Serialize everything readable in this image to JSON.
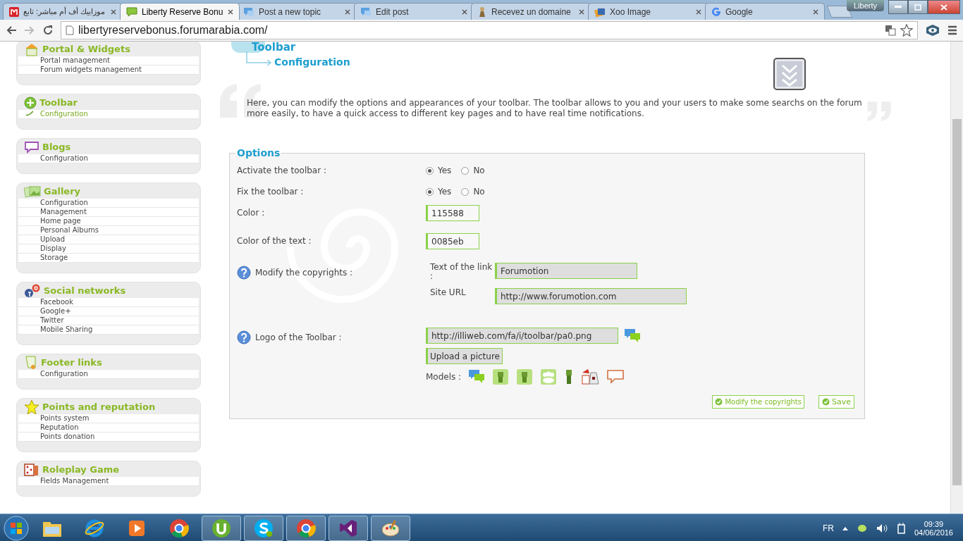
{
  "browser": {
    "tabs": [
      {
        "title": "موزاييك أف أم مباشر: تابع",
        "selected": false,
        "kind": "m"
      },
      {
        "title": "Liberty Reserve Bonu",
        "selected": true,
        "kind": "chat-green"
      },
      {
        "title": "Post a new topic",
        "selected": false,
        "kind": "chat-blue"
      },
      {
        "title": "Edit post",
        "selected": false,
        "kind": "chat-blue"
      },
      {
        "title": "Recevez un domaine",
        "selected": false,
        "kind": "figure"
      },
      {
        "title": "Xoo Image",
        "selected": false,
        "kind": "xoo"
      },
      {
        "title": "Google",
        "selected": false,
        "kind": "google"
      }
    ],
    "profile": "Liberty",
    "url": "libertyreservebonus.forumarabia.com/"
  },
  "sidebar": [
    {
      "title": "Portal & Widgets",
      "kind": "house",
      "items": [
        {
          "label": "Portal management",
          "selected": false
        },
        {
          "label": "Forum widgets management",
          "selected": false
        }
      ]
    },
    {
      "title": "Toolbar",
      "kind": "plus",
      "items": [
        {
          "label": "Configuration",
          "selected": true
        }
      ]
    },
    {
      "title": "Blogs",
      "kind": "bubble",
      "items": [
        {
          "label": "Configuration",
          "selected": false
        }
      ]
    },
    {
      "title": "Gallery",
      "kind": "photos",
      "items": [
        {
          "label": "Configuration",
          "selected": false
        },
        {
          "label": "Management",
          "selected": false
        },
        {
          "label": "Home page",
          "selected": false
        },
        {
          "label": "Personal Albums",
          "selected": false
        },
        {
          "label": "Upload",
          "selected": false
        },
        {
          "label": "Display",
          "selected": false
        },
        {
          "label": "Storage",
          "selected": false
        }
      ]
    },
    {
      "title": "Social networks",
      "kind": "social",
      "items": [
        {
          "label": "Facebook",
          "selected": false
        },
        {
          "label": "Google+",
          "selected": false
        },
        {
          "label": "Twitter",
          "selected": false
        },
        {
          "label": "Mobile Sharing",
          "selected": false
        }
      ]
    },
    {
      "title": "Footer links",
      "kind": "scroll",
      "items": [
        {
          "label": "Configuration",
          "selected": false
        }
      ]
    },
    {
      "title": "Points and reputation",
      "kind": "star",
      "items": [
        {
          "label": "Points system",
          "selected": false
        },
        {
          "label": "Reputation",
          "selected": false
        },
        {
          "label": "Points donation",
          "selected": false
        }
      ]
    },
    {
      "title": "Roleplay Game",
      "kind": "dice",
      "items": [
        {
          "label": "Fields Management",
          "selected": false
        }
      ]
    }
  ],
  "page": {
    "section": "Toolbar",
    "subsection": "Configuration",
    "description": "Here, you can modify the options and appearances of your toolbar. The toolbar allows to you and your users to make some searchs on the forum more easily, to have a quick access to different key pages and to have real time notifications.",
    "options": {
      "legend": "Options",
      "rows": [
        {
          "kind": "radio",
          "label": "Activate the toolbar :",
          "options": [
            {
              "label": "Yes",
              "selected": true
            },
            {
              "label": "No",
              "selected": false
            }
          ]
        },
        {
          "kind": "radio",
          "label": "Fix the toolbar :",
          "options": [
            {
              "label": "Yes",
              "selected": true
            },
            {
              "label": "No",
              "selected": false
            }
          ]
        },
        {
          "kind": "field",
          "label": "Color :",
          "value": "115588"
        },
        {
          "kind": "field",
          "label": "Color of the text :",
          "value": "0085eb"
        },
        {
          "kind": "group",
          "label": "Modify the copyrights :",
          "fields": [
            {
              "label": "Text of the link :",
              "value": "Forumotion"
            },
            {
              "label": "Site URL",
              "value": "http://www.forumotion.com"
            }
          ]
        },
        {
          "kind": "logo",
          "label": "Logo of the Toolbar :",
          "value": "http://illiweb.com/fa/i/toolbar/pa0.png",
          "upload": "Upload a picture",
          "models_label": "Models :",
          "models": [
            {
              "kind": "chat"
            },
            {
              "kind": "robot"
            },
            {
              "kind": "robot"
            },
            {
              "kind": "group"
            },
            {
              "kind": "robot-small"
            },
            {
              "kind": "dice"
            },
            {
              "kind": "speech"
            }
          ]
        }
      ],
      "buttons": [
        {
          "label": "Modify the copyrights"
        },
        {
          "label": "Save"
        }
      ]
    }
  },
  "taskbar": {
    "apps": [
      {
        "kind": "folder",
        "running": false
      },
      {
        "kind": "ie",
        "running": false
      },
      {
        "kind": "media",
        "running": false
      },
      {
        "kind": "chrome",
        "running": false
      },
      {
        "kind": "utorrent",
        "running": true
      },
      {
        "kind": "skype",
        "running": true
      },
      {
        "kind": "chrome",
        "running": true
      },
      {
        "kind": "vs",
        "running": true
      },
      {
        "kind": "paint",
        "running": true
      }
    ],
    "language": "FR",
    "time": "09:39",
    "date": "04/06/2016"
  }
}
